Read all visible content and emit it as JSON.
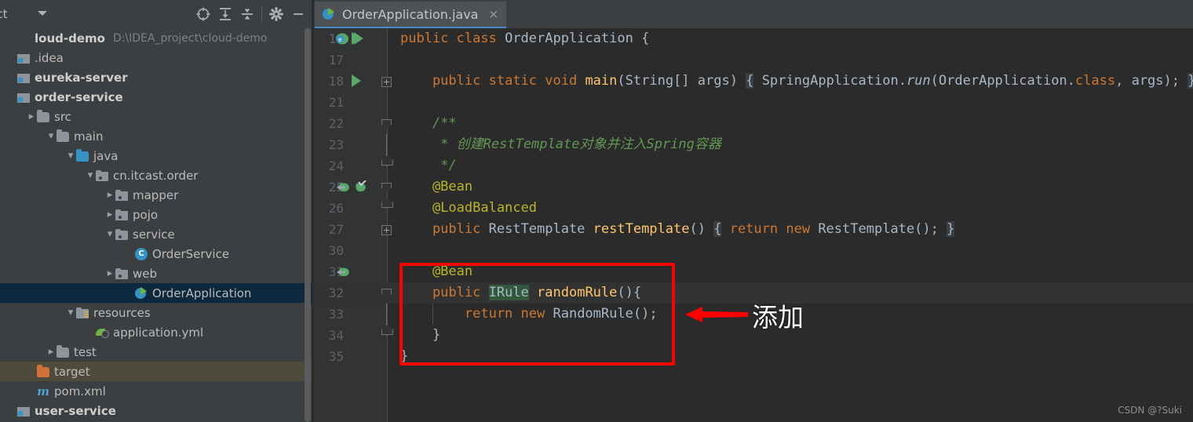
{
  "project_panel": {
    "title": "ject",
    "toolbar_icons": [
      {
        "name": "locate-icon",
        "glyph": "crosshair"
      },
      {
        "name": "expand-all-icon",
        "glyph": "expand"
      },
      {
        "name": "collapse-all-icon",
        "glyph": "collapse"
      },
      {
        "name": "settings-gear-icon",
        "glyph": "gear"
      },
      {
        "name": "hide-panel-icon",
        "glyph": "minus"
      }
    ],
    "tree": [
      {
        "label": "loud-demo",
        "path": "D:\\IDEA_project\\cloud-demo",
        "indent": 0,
        "arrow": "",
        "icon": "none",
        "style": "bold",
        "state": "normal"
      },
      {
        "label": ".idea",
        "path": "",
        "indent": 0,
        "arrow": "",
        "icon": "module",
        "style": "normal",
        "state": "normal"
      },
      {
        "label": "eureka-server",
        "path": "",
        "indent": 0,
        "arrow": "",
        "icon": "module",
        "style": "bold",
        "state": "normal"
      },
      {
        "label": "order-service",
        "path": "",
        "indent": 0,
        "arrow": "",
        "icon": "module",
        "style": "bold",
        "state": "normal"
      },
      {
        "label": "src",
        "path": "",
        "indent": 1,
        "arrow": "right",
        "icon": "folder",
        "style": "normal",
        "state": "normal"
      },
      {
        "label": "main",
        "path": "",
        "indent": 2,
        "arrow": "down",
        "icon": "folder",
        "style": "normal",
        "state": "normal"
      },
      {
        "label": "java",
        "path": "",
        "indent": 3,
        "arrow": "down",
        "icon": "folder-blue",
        "style": "normal",
        "state": "normal"
      },
      {
        "label": "cn.itcast.order",
        "path": "",
        "indent": 4,
        "arrow": "down",
        "icon": "package",
        "style": "normal",
        "state": "normal"
      },
      {
        "label": "mapper",
        "path": "",
        "indent": 5,
        "arrow": "right",
        "icon": "package",
        "style": "normal",
        "state": "normal"
      },
      {
        "label": "pojo",
        "path": "",
        "indent": 5,
        "arrow": "right",
        "icon": "package",
        "style": "normal",
        "state": "normal"
      },
      {
        "label": "service",
        "path": "",
        "indent": 5,
        "arrow": "down",
        "icon": "package",
        "style": "normal",
        "state": "normal"
      },
      {
        "label": "OrderService",
        "path": "",
        "indent": 6,
        "arrow": "",
        "icon": "class",
        "style": "normal",
        "state": "normal"
      },
      {
        "label": "web",
        "path": "",
        "indent": 5,
        "arrow": "right",
        "icon": "package",
        "style": "normal",
        "state": "normal"
      },
      {
        "label": "OrderApplication",
        "path": "",
        "indent": 6,
        "arrow": "",
        "icon": "springboot",
        "style": "normal",
        "state": "selected"
      },
      {
        "label": "resources",
        "path": "",
        "indent": 3,
        "arrow": "down",
        "icon": "resources",
        "style": "normal",
        "state": "normal"
      },
      {
        "label": "application.yml",
        "path": "",
        "indent": 4,
        "arrow": "",
        "icon": "spring-leaf",
        "style": "normal",
        "state": "normal"
      },
      {
        "label": "test",
        "path": "",
        "indent": 2,
        "arrow": "right",
        "icon": "folder",
        "style": "normal",
        "state": "normal"
      },
      {
        "label": "target",
        "path": "",
        "indent": 1,
        "arrow": "",
        "icon": "folder-orange",
        "style": "normal",
        "state": "highlighted"
      },
      {
        "label": "pom.xml",
        "path": "",
        "indent": 1,
        "arrow": "",
        "icon": "maven",
        "style": "normal",
        "state": "normal"
      },
      {
        "label": "user-service",
        "path": "",
        "indent": 0,
        "arrow": "",
        "icon": "module",
        "style": "bold",
        "state": "normal"
      }
    ]
  },
  "editor": {
    "tab": {
      "label": "OrderApplication.java",
      "icon": "springboot-icon",
      "close": "×"
    },
    "lines": [
      {
        "num": "16",
        "gutter": [
          "bean-run",
          "run"
        ],
        "fold": "",
        "current": false,
        "tokens": [
          {
            "t": "public ",
            "c": "kw"
          },
          {
            "t": "class ",
            "c": "kw"
          },
          {
            "t": "OrderApplication",
            "c": "cls"
          },
          {
            "t": " {",
            "c": "punct"
          }
        ],
        "indent": 0
      },
      {
        "num": "17",
        "gutter": [],
        "fold": "",
        "current": false,
        "tokens": [],
        "indent": 0
      },
      {
        "num": "18",
        "gutter": [
          "run"
        ],
        "fold": "box-plus",
        "current": false,
        "tokens": [
          {
            "t": "    public ",
            "c": "kw"
          },
          {
            "t": "static ",
            "c": "kw"
          },
          {
            "t": "void ",
            "c": "kw"
          },
          {
            "t": "main",
            "c": "meth"
          },
          {
            "t": "(",
            "c": "punct"
          },
          {
            "t": "String",
            "c": "cls"
          },
          {
            "t": "[] args) ",
            "c": "punct"
          },
          {
            "t": "{",
            "c": "foldph"
          },
          {
            "t": " ",
            "c": "punct"
          },
          {
            "t": "SpringApplication",
            "c": "cls"
          },
          {
            "t": ".",
            "c": "punct"
          },
          {
            "t": "run",
            "c": "statfld"
          },
          {
            "t": "(",
            "c": "punct"
          },
          {
            "t": "OrderApplication",
            "c": "cls"
          },
          {
            "t": ".",
            "c": "punct"
          },
          {
            "t": "class",
            "c": "kw"
          },
          {
            "t": ", args);",
            "c": "punct"
          },
          {
            "t": " ",
            "c": "punct"
          },
          {
            "t": "}",
            "c": "foldph"
          }
        ],
        "indent": 0
      },
      {
        "num": "21",
        "gutter": [],
        "fold": "",
        "current": false,
        "tokens": [],
        "indent": 0
      },
      {
        "num": "22",
        "gutter": [],
        "fold": "top",
        "current": false,
        "tokens": [
          {
            "t": "    /**",
            "c": "cmt"
          }
        ],
        "indent": 0
      },
      {
        "num": "23",
        "gutter": [],
        "fold": "line",
        "current": false,
        "tokens": [
          {
            "t": "     * 创建RestTemplate对象并注入Spring容器",
            "c": "cmt"
          }
        ],
        "indent": 0
      },
      {
        "num": "24",
        "gutter": [],
        "fold": "bot",
        "current": false,
        "tokens": [
          {
            "t": "     */",
            "c": "cmt"
          }
        ],
        "indent": 0
      },
      {
        "num": "25",
        "gutter": [
          "bean-arrow",
          "bean-check"
        ],
        "fold": "top",
        "current": false,
        "tokens": [
          {
            "t": "    @Bean",
            "c": "ann"
          }
        ],
        "indent": 0
      },
      {
        "num": "26",
        "gutter": [],
        "fold": "bot",
        "current": false,
        "tokens": [
          {
            "t": "    @LoadBalanced",
            "c": "ann"
          }
        ],
        "indent": 0
      },
      {
        "num": "27",
        "gutter": [],
        "fold": "box-plus",
        "current": false,
        "tokens": [
          {
            "t": "    public ",
            "c": "kw"
          },
          {
            "t": "RestTemplate ",
            "c": "cls"
          },
          {
            "t": "restTemplate",
            "c": "meth"
          },
          {
            "t": "() ",
            "c": "punct"
          },
          {
            "t": "{",
            "c": "foldph"
          },
          {
            "t": " ",
            "c": "punct"
          },
          {
            "t": "return ",
            "c": "kw"
          },
          {
            "t": "new ",
            "c": "kw"
          },
          {
            "t": "RestTemplate",
            "c": "cls"
          },
          {
            "t": "();",
            "c": "punct"
          },
          {
            "t": " ",
            "c": "punct"
          },
          {
            "t": "}",
            "c": "foldph"
          }
        ],
        "indent": 0
      },
      {
        "num": "30",
        "gutter": [],
        "fold": "",
        "current": false,
        "tokens": [],
        "indent": 0
      },
      {
        "num": "31",
        "gutter": [
          "bean-arrow"
        ],
        "fold": "",
        "current": false,
        "tokens": [
          {
            "t": "    @Bean",
            "c": "ann"
          }
        ],
        "indent": 0
      },
      {
        "num": "32",
        "gutter": [],
        "fold": "top",
        "current": true,
        "tokens": [
          {
            "t": "    public ",
            "c": "kw"
          },
          {
            "t": "IRule",
            "c": "sel-green"
          },
          {
            "t": " ",
            "c": "punct"
          },
          {
            "t": "randomRule",
            "c": "meth"
          },
          {
            "t": "(){",
            "c": "punct"
          }
        ],
        "indent": 0
      },
      {
        "num": "33",
        "gutter": [],
        "fold": "line",
        "current": false,
        "tokens": [
          {
            "t": "        return ",
            "c": "kw"
          },
          {
            "t": "new ",
            "c": "kw"
          },
          {
            "t": "RandomRule",
            "c": "cls"
          },
          {
            "t": "();",
            "c": "punct"
          }
        ],
        "indent": 1
      },
      {
        "num": "34",
        "gutter": [],
        "fold": "bot",
        "current": false,
        "tokens": [
          {
            "t": "    }",
            "c": "punct"
          }
        ],
        "indent": 0
      },
      {
        "num": "35",
        "gutter": [],
        "fold": "",
        "current": false,
        "tokens": [
          {
            "t": "}",
            "c": "punct"
          }
        ],
        "indent": 0
      }
    ]
  },
  "annotations": {
    "highlight_box_color": "#FF0000",
    "arrow_color": "#FF0000",
    "label": "添加"
  },
  "watermark": "CSDN @?Suki"
}
